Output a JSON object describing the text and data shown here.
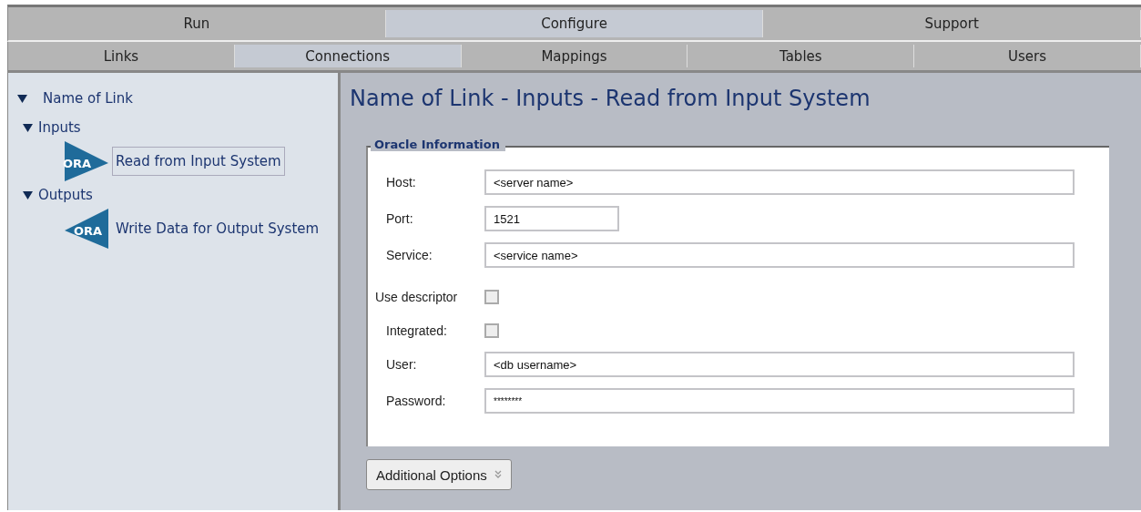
{
  "main_tabs": [
    {
      "label": "Run",
      "selected": false
    },
    {
      "label": "Configure",
      "selected": true
    },
    {
      "label": "Support",
      "selected": false
    }
  ],
  "sub_tabs": [
    {
      "label": "Links",
      "selected": false
    },
    {
      "label": "Connections",
      "selected": true
    },
    {
      "label": "Mappings",
      "selected": false
    },
    {
      "label": "Tables",
      "selected": false
    },
    {
      "label": "Users",
      "selected": false
    }
  ],
  "tree": [
    {
      "label": "Name of Link",
      "expanded": true,
      "children": [
        {
          "label": "Inputs",
          "expanded": true,
          "children": [
            {
              "label": "Read from Input System",
              "kind": "input",
              "badge": "ORA",
              "selected": true
            }
          ]
        },
        {
          "label": "Outputs",
          "expanded": true,
          "children": [
            {
              "label": "Write Data for Output System",
              "kind": "output",
              "badge": "ORA",
              "selected": false
            }
          ]
        }
      ]
    }
  ],
  "page_title": "Name of Link - Inputs - Read from Input System",
  "group": {
    "legend": "Oracle Information",
    "fields": [
      {
        "kind": "text",
        "label": "Host:",
        "value": "<server name>"
      },
      {
        "kind": "short_text",
        "label": "Port:",
        "value": "1521"
      },
      {
        "kind": "text",
        "label": "Service:",
        "value": "<service name>"
      },
      {
        "kind": "section_checkbox",
        "label": "Use descriptor",
        "checked": false
      },
      {
        "kind": "checkbox",
        "label": "Integrated:",
        "checked": false
      },
      {
        "kind": "text",
        "label": "User:",
        "value": "<db username>"
      },
      {
        "kind": "password",
        "label": "Password:",
        "value": "********"
      }
    ]
  },
  "options_button": {
    "label": "Additional Options"
  }
}
